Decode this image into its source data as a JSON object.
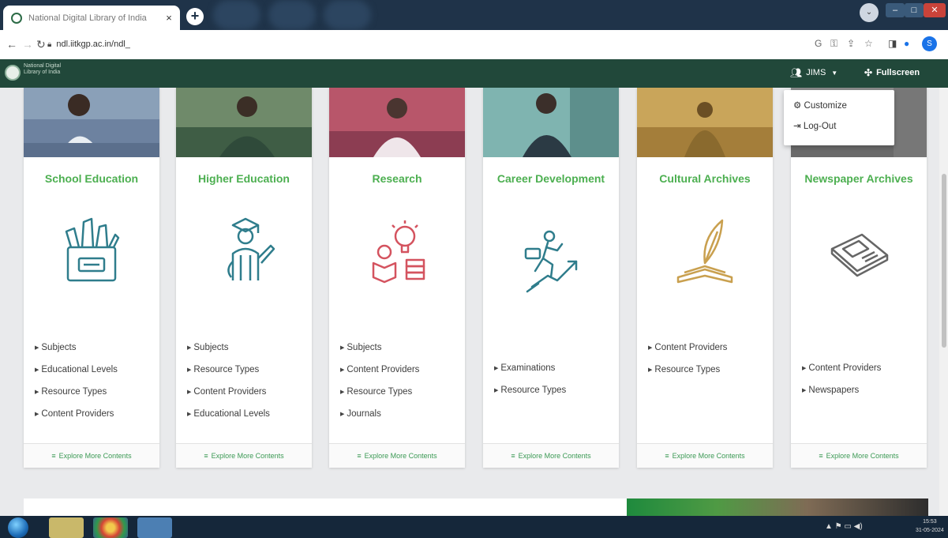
{
  "browser": {
    "tab_title": "National Digital Library of India",
    "tab_close": "×",
    "new_tab": "+",
    "url": "ndl.iitkgp.ac.in/ndl_",
    "lock_icon": "lock-icon",
    "profile_initial": "S"
  },
  "site": {
    "logo_text": "National Digital Library of India",
    "user_name": "JIMS",
    "fullscreen_label": "Fullscreen",
    "dropdown": {
      "customize_label": "Customize",
      "logout_label": "Log-Out"
    }
  },
  "cards": [
    {
      "title": "School Education",
      "links": [
        "Subjects",
        "Educational Levels",
        "Resource Types",
        "Content Providers"
      ],
      "footer": "Explore More Contents"
    },
    {
      "title": "Higher Education",
      "links": [
        "Subjects",
        "Resource Types",
        "Content Providers",
        "Educational Levels"
      ],
      "footer": "Explore More Contents"
    },
    {
      "title": "Research",
      "links": [
        "Subjects",
        "Content Providers",
        "Resource Types",
        "Journals"
      ],
      "footer": "Explore More Contents"
    },
    {
      "title": "Career Development",
      "links": [
        "Examinations",
        "Resource Types"
      ],
      "footer": "Explore More Contents"
    },
    {
      "title": "Cultural Archives",
      "links": [
        "Content Providers",
        "Resource Types"
      ],
      "footer": "Explore More Contents"
    },
    {
      "title": "Newspaper Archives",
      "links": [
        "Content Providers",
        "Newspapers"
      ],
      "footer": "Explore More Contents"
    }
  ],
  "taskbar": {
    "time": "15:53",
    "date": "31-05-2024"
  },
  "colors": {
    "header_green": "#21483a",
    "card_title_green": "#4caf50",
    "research_red": "#d4535f",
    "career_blue": "#2f7d8c",
    "cultural_gold": "#c9a04f"
  }
}
